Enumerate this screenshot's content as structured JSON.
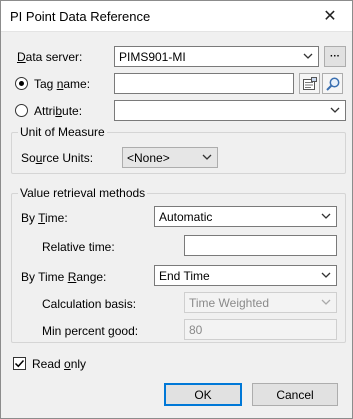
{
  "window": {
    "title": "PI Point Data Reference",
    "close_symbol": "✕"
  },
  "data_server": {
    "label_prefix": "D",
    "label_rest": "ata server:",
    "value": "PIMS901-MI",
    "more_button": "···"
  },
  "tag_name": {
    "label_prefix": "Tag ",
    "label_u": "n",
    "label_rest": "ame:",
    "value": "",
    "selected": true
  },
  "attribute": {
    "label_prefix": "Attri",
    "label_u": "b",
    "label_rest": "ute:",
    "value": "",
    "selected": false
  },
  "unit_of_measure": {
    "group_title": "Unit of Measure",
    "source_units_label_prefix": "So",
    "source_units_label_u": "u",
    "source_units_label_rest": "rce Units:",
    "source_units_value": "<None>"
  },
  "value_retrieval": {
    "group_title": "Value retrieval methods",
    "by_time_label_prefix": "By ",
    "by_time_label_u": "T",
    "by_time_label_rest": "ime:",
    "by_time_value": "Automatic",
    "relative_time_label": "Relative time:",
    "relative_time_value": "",
    "by_time_range_label_prefix": "By Time ",
    "by_time_range_label_u": "R",
    "by_time_range_label_rest": "ange:",
    "by_time_range_value": "End Time",
    "calculation_basis_label": "Calculation basis:",
    "calculation_basis_value": "Time Weighted",
    "min_percent_good_label_prefix": "Min percent ",
    "min_percent_good_label_u": "g",
    "min_percent_good_label_rest": "ood:",
    "min_percent_good_value": "80"
  },
  "read_only": {
    "label_prefix": "Read ",
    "label_u": "o",
    "label_rest": "nly",
    "checked": true
  },
  "buttons": {
    "ok": "OK",
    "cancel": "Cancel"
  }
}
